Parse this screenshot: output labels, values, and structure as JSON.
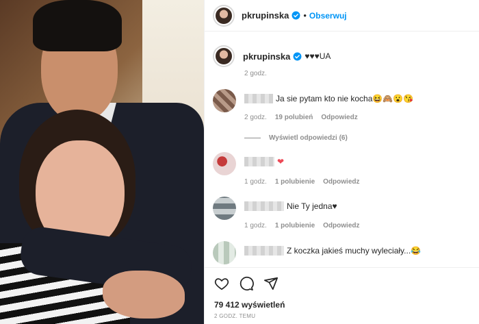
{
  "header": {
    "username": "pkrupinska",
    "follow_label": "Obserwuj",
    "separator": "•"
  },
  "caption": {
    "username": "pkrupinska",
    "text": "♥♥♥UA",
    "time": "2 godz."
  },
  "comments": [
    {
      "text": "Ja sie pytam kto nie kocha😆🙈😮😘",
      "time": "2 godz.",
      "likes": "19 polubień",
      "reply": "Odpowiedz",
      "view_replies": "Wyświetl odpowiedzi (6)"
    },
    {
      "text": "❤",
      "time": "1 godz.",
      "likes": "1 polubienie",
      "reply": "Odpowiedz"
    },
    {
      "text": "Nie Ty jedna♥",
      "time": "1 godz.",
      "likes": "1 polubienie",
      "reply": "Odpowiedz"
    },
    {
      "text": "Z koczka jakieś muchy wyleciały...😂"
    }
  ],
  "footer": {
    "views": "79 412 wyświetleń",
    "posted": "2 GODZ. TEMU"
  },
  "icons": [
    "verified-badge-icon",
    "heart-icon",
    "comment-icon",
    "share-icon"
  ],
  "colors": {
    "accent": "#0095f6",
    "muted": "#8e8e8e",
    "text": "#262626",
    "heart_red": "#ed4956"
  }
}
